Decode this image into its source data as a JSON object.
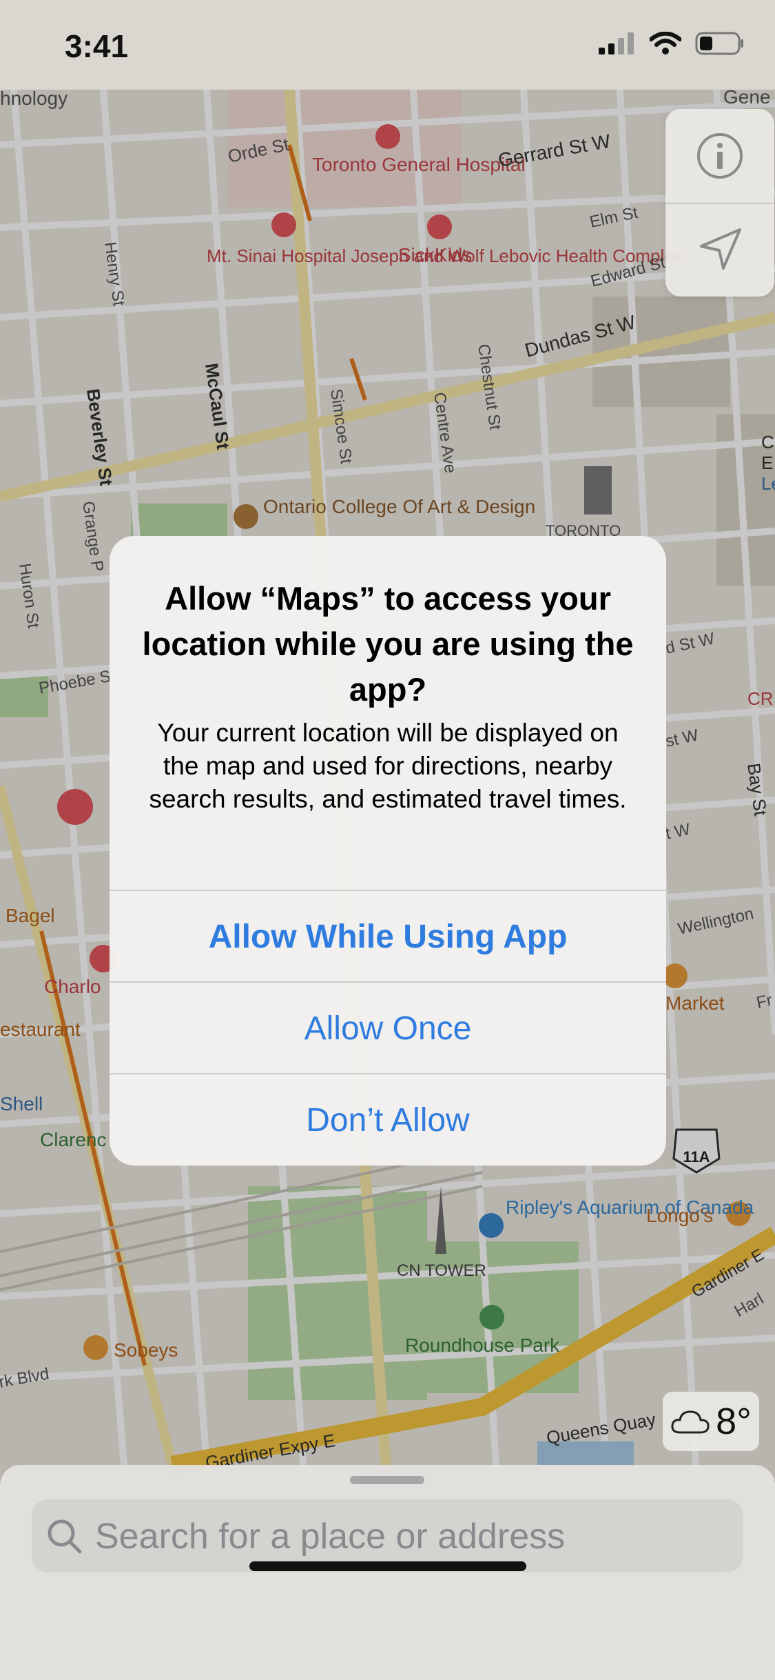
{
  "status_bar": {
    "time": "3:41"
  },
  "map": {
    "street_labels": [
      "Gerrard St W",
      "Orde St",
      "Elm St",
      "Edward St",
      "Dundas St W",
      "Henry St",
      "McCaul St",
      "Beverley St",
      "Simcoe St",
      "Centre Ave",
      "Chestnut St",
      "Grange P",
      "Huron St",
      "Phoebe S",
      "Bay St",
      "Wellington",
      "Queens Quay",
      "Gardiner Expy E",
      "Gardiner E",
      "rk Blvd",
      "d St W",
      "st W",
      "t W",
      "Harl",
      "Fr"
    ],
    "poi_labels": [
      "hnology",
      "Toronto General Hospital",
      "SickKids",
      "Mt. Sinai Hospital Joseph and Wolf Lebovic Health Complex",
      "Ontario College Of Art & Design",
      "TORONTO",
      "Bagel",
      "Charlo",
      "estaurant",
      "Shell",
      "Clarenc",
      "Market",
      "Ripley's Aquarium of Canada",
      "Longo's",
      "CN TOWER",
      "Roundhouse Park",
      "Sobeys",
      "CR",
      "C",
      "E",
      "Le",
      "Gene"
    ],
    "highway_shield": "11A"
  },
  "controls": {
    "info_icon": "info-icon",
    "location_icon": "location-arrow-icon"
  },
  "weather": {
    "temperature": "8°",
    "icon": "cloud-icon"
  },
  "alert": {
    "title": "Allow “Maps” to access your location while you are using the app?",
    "message": "Your current location will be displayed on the map and used for directions, nearby search results, and estimated travel times.",
    "buttons": {
      "allow_while_using": "Allow While Using App",
      "allow_once": "Allow Once",
      "dont_allow": "Don’t Allow"
    }
  },
  "search": {
    "placeholder": "Search for a place or address"
  }
}
